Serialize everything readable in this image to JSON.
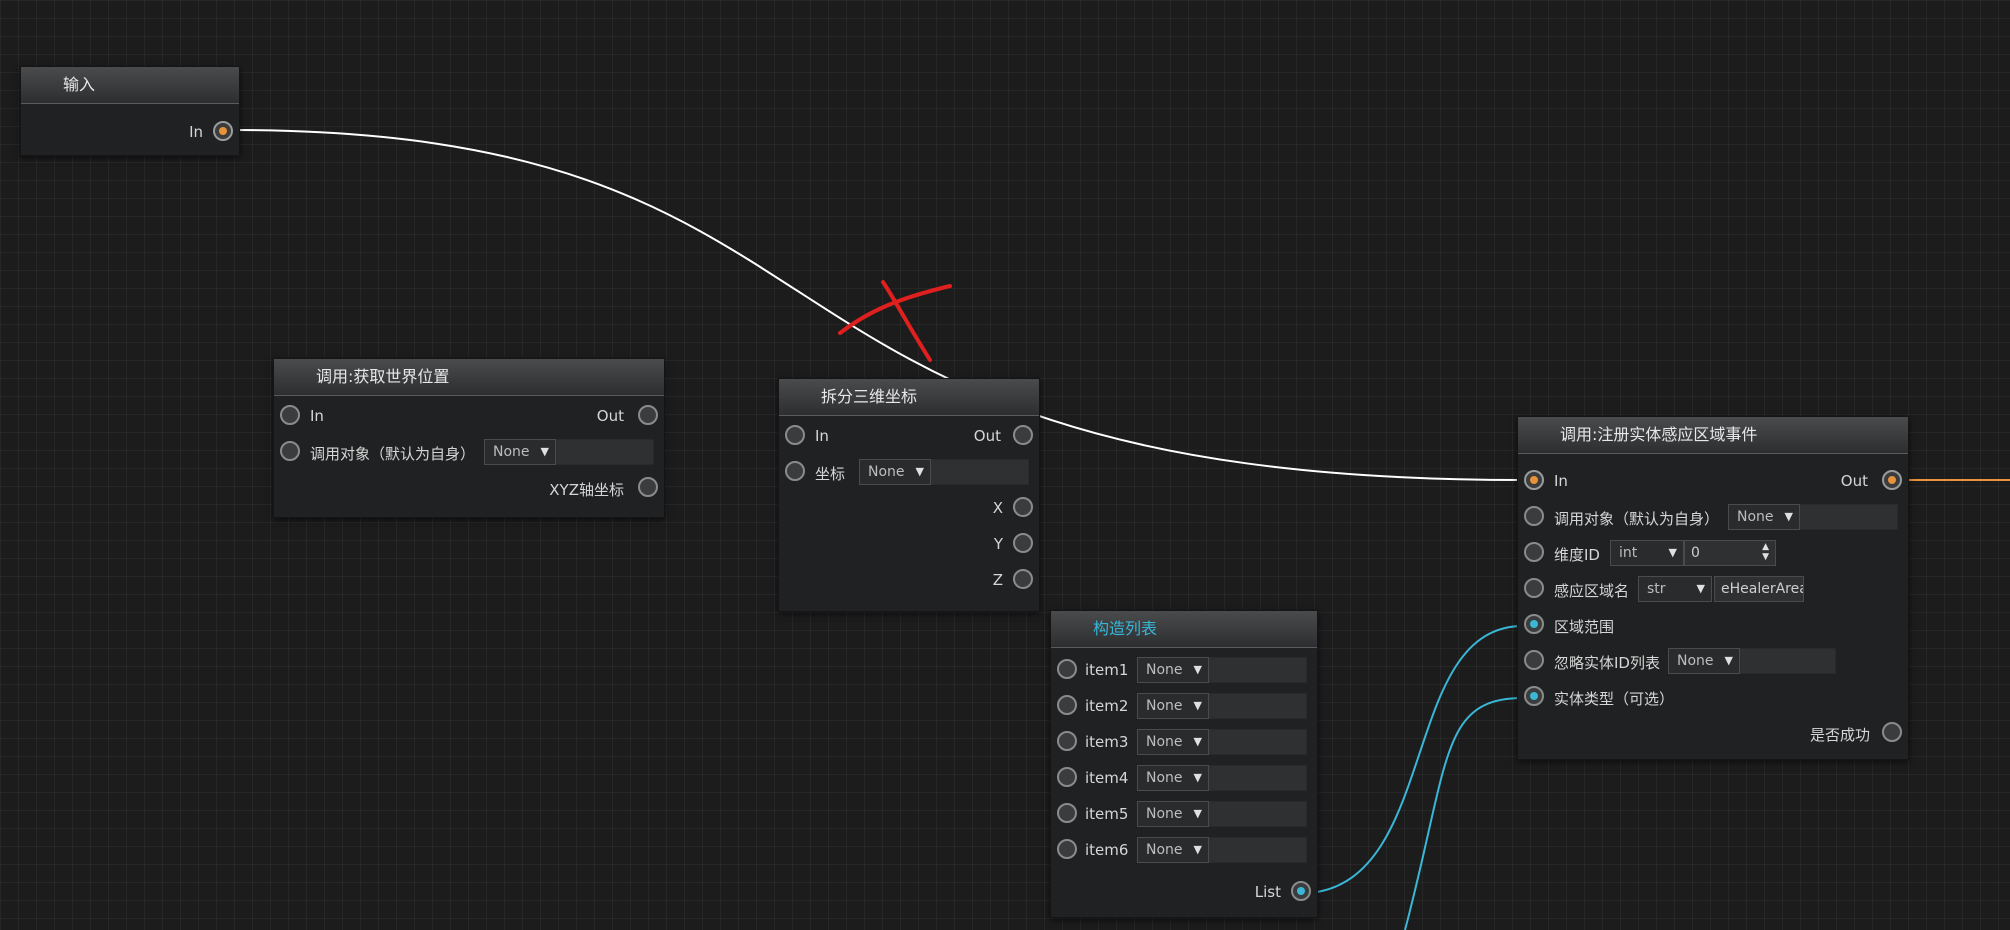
{
  "nodes": {
    "input": {
      "title": "输入",
      "in_label": "In"
    },
    "get_world_pos": {
      "title": "调用:获取世界位置",
      "in_label": "In",
      "out_label": "Out",
      "caller_label": "调用对象（默认为自身）",
      "caller_value": "None",
      "xyz_label": "XYZ轴坐标"
    },
    "split_vec3": {
      "title": "拆分三维坐标",
      "in_label": "In",
      "out_label": "Out",
      "coord_label": "坐标",
      "coord_value": "None",
      "x_label": "X",
      "y_label": "Y",
      "z_label": "Z"
    },
    "build_list": {
      "title": "构造列表",
      "items": [
        {
          "label": "item1",
          "value": "None"
        },
        {
          "label": "item2",
          "value": "None"
        },
        {
          "label": "item3",
          "value": "None"
        },
        {
          "label": "item4",
          "value": "None"
        },
        {
          "label": "item5",
          "value": "None"
        },
        {
          "label": "item6",
          "value": "None"
        }
      ],
      "list_label": "List"
    },
    "register_event": {
      "title": "调用:注册实体感应区域事件",
      "in_label": "In",
      "out_label": "Out",
      "caller_label": "调用对象（默认为自身）",
      "caller_value": "None",
      "dim_label": "维度ID",
      "dim_type": "int",
      "dim_value": "0",
      "area_name_label": "感应区域名",
      "area_name_type": "str",
      "area_name_value": "eHealerArea",
      "range_label": "区域范围",
      "ignore_label": "忽略实体ID列表",
      "ignore_value": "None",
      "entity_type_label": "实体类型（可选）",
      "success_label": "是否成功"
    }
  },
  "colors": {
    "exec_wire": "#ffffff",
    "data_wire": "#3ab7d6",
    "out_wire": "#e8923a",
    "annotation_mark": "#e0201e",
    "title_accent": "#38b6d8"
  }
}
